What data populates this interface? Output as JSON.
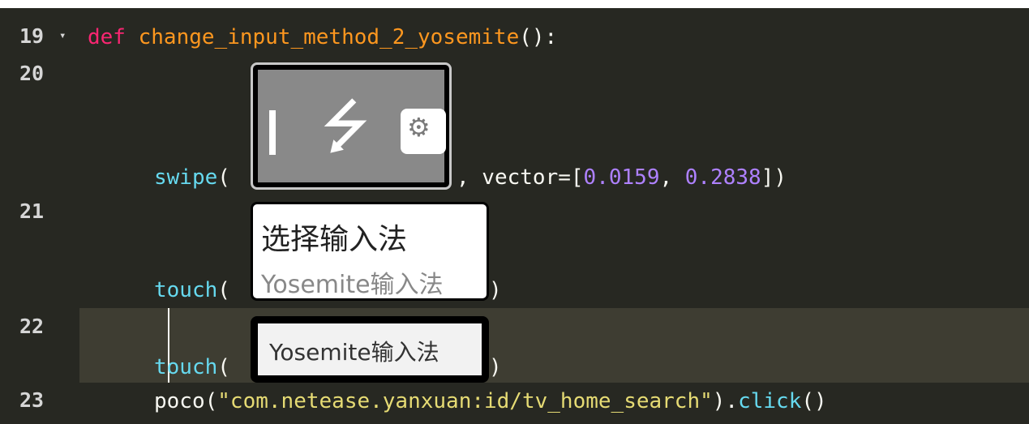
{
  "lines": [
    {
      "num": "19",
      "parts": [
        "def",
        " ",
        "change_input_method_2_yosemite",
        "():"
      ]
    },
    {
      "num": "20",
      "call": "swipe",
      "open": "(",
      "after": ", vector=[",
      "v1": "0.0159",
      "sep": ", ",
      "v2": "0.2838",
      "close": "])"
    },
    {
      "num": "21",
      "call": "touch",
      "open": "(",
      "close": ")"
    },
    {
      "num": "22",
      "call": "touch",
      "open": "(",
      "close": ")"
    },
    {
      "num": "23",
      "poco": "poco(",
      "str": "\"com.netease.yanxuan:id/tv_home_search\"",
      "mid": ").",
      "method": "click",
      "end": "()"
    }
  ],
  "images": {
    "select_title": "选择输入法",
    "select_option": "Yosemite输入法",
    "yosemite_option": "Yosemite输入法",
    "usb_icon": "usb-icon",
    "usb_settings_icon": "usb-settings-icon"
  },
  "fold_marker": "▾",
  "colors": {
    "background": "#272822",
    "keyword": "#f92672",
    "function": "#fd971f",
    "call": "#66d9ef",
    "number": "#ae81ff",
    "string": "#e6db74",
    "current_line": "#3e3d32"
  }
}
